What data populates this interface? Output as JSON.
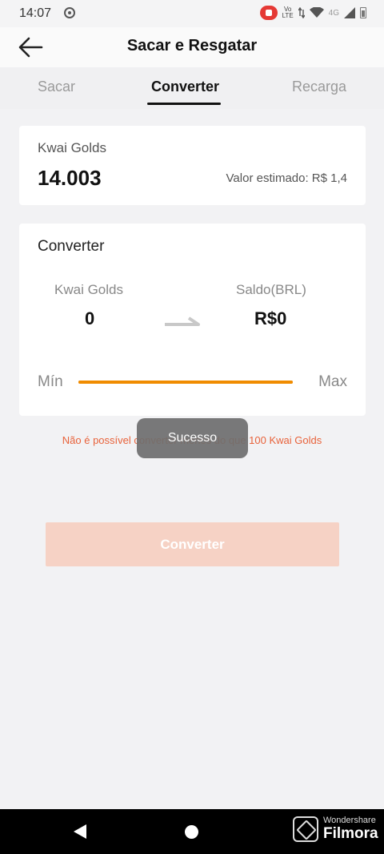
{
  "status_bar": {
    "time": "14:07",
    "volte": "Vo",
    "lte": "LTE",
    "network": "4G"
  },
  "header": {
    "title": "Sacar e Resgatar"
  },
  "tabs": [
    {
      "label": "Sacar",
      "active": false
    },
    {
      "label": "Converter",
      "active": true
    },
    {
      "label": "Recarga",
      "active": false
    }
  ],
  "balance_card": {
    "label": "Kwai Golds",
    "value": "14.003",
    "estimate": "Valor estimado: R$ 1,4"
  },
  "convert_card": {
    "title": "Converter",
    "from_label": "Kwai Golds",
    "from_value": "0",
    "to_label": "Saldo(BRL)",
    "to_value": "R$0",
    "min_label": "Mín",
    "max_label": "Max",
    "slider_position": 0
  },
  "warning": "Não é possível converter menos do que 100 Kwai Golds",
  "toast": "Sucesso",
  "convert_button": "Converter",
  "watermark": {
    "brand_small": "Wondershare",
    "brand_big": "Filmora"
  },
  "colors": {
    "accent": "#f08c00",
    "warning": "#e8623a",
    "button_disabled": "#f6d2c5"
  }
}
